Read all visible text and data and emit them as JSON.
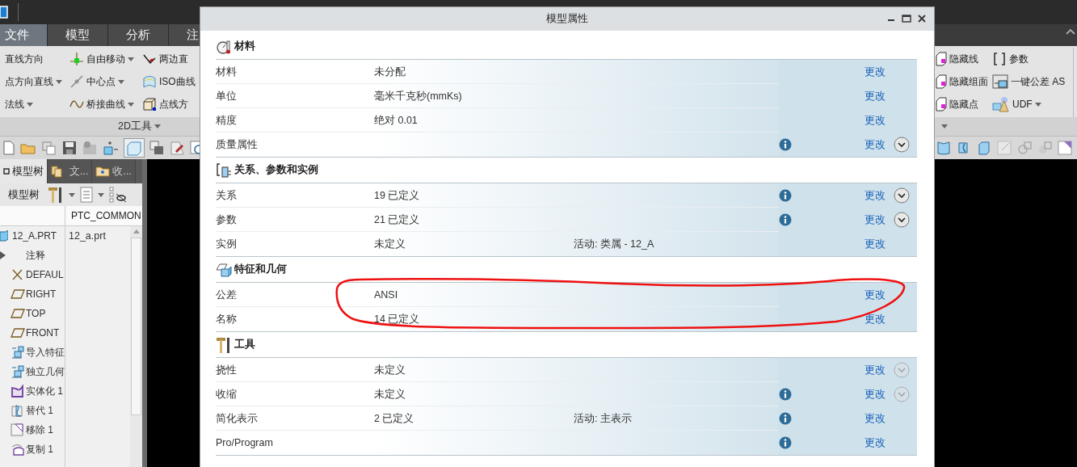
{
  "ribbon": {
    "tabs": [
      {
        "label": "文件",
        "selected": true
      },
      {
        "label": "模型",
        "selected": false
      },
      {
        "label": "分析",
        "selected": false
      },
      {
        "label": "注",
        "selected": false
      }
    ],
    "left_items": [
      {
        "label": "直线方向",
        "dropdown": false,
        "kind": "plain"
      },
      {
        "label": "自由移动",
        "dropdown": true,
        "kind": "axes"
      },
      {
        "label": "两边直",
        "dropdown": false,
        "kind": "angle"
      },
      {
        "label": "点方向直线",
        "dropdown": true,
        "kind": "plain"
      },
      {
        "label": "中心点",
        "dropdown": true,
        "kind": "line"
      },
      {
        "label": "ISO曲线",
        "dropdown": false,
        "kind": "surface"
      },
      {
        "label": "法线",
        "dropdown": true,
        "kind": "plain"
      },
      {
        "label": "桥接曲线",
        "dropdown": true,
        "kind": "curve"
      },
      {
        "label": "点线方",
        "dropdown": false,
        "kind": "cube"
      }
    ],
    "left_group": "2D工具",
    "right_items": [
      {
        "label": "隐藏线",
        "dropdown": false,
        "kind": "hide"
      },
      {
        "label": "参数",
        "dropdown": false,
        "kind": "brackets"
      },
      {
        "label": "隐藏组面",
        "dropdown": false,
        "kind": "hide"
      },
      {
        "label": "一键公差 AS",
        "dropdown": false,
        "kind": "frame"
      },
      {
        "label": "隐藏点",
        "dropdown": false,
        "kind": "hide"
      },
      {
        "label": "UDF",
        "dropdown": true,
        "kind": "cone"
      }
    ]
  },
  "panel": {
    "tabs": [
      {
        "label": "模型树",
        "selected": true,
        "kind": "square"
      },
      {
        "label": "文...",
        "selected": false,
        "kind": "folder"
      },
      {
        "label": "收...",
        "selected": false,
        "kind": "star-folder"
      }
    ],
    "toolbar_label": "模型树",
    "column_2": "PTC_COMMON",
    "tree": {
      "name": "12_A.PRT",
      "value": "12_a.prt",
      "children": [
        {
          "name": "注释",
          "kind": "plain",
          "expanded": false
        },
        {
          "name": "DEFAUL",
          "kind": "csys"
        },
        {
          "name": "RIGHT",
          "kind": "plane"
        },
        {
          "name": "TOP",
          "kind": "plane"
        },
        {
          "name": "FRONT",
          "kind": "plane"
        },
        {
          "name": "导入特征",
          "kind": "import"
        },
        {
          "name": "独立几何",
          "kind": "import"
        },
        {
          "name": "实体化 1",
          "kind": "solidify"
        },
        {
          "name": "替代 1",
          "kind": "substitute"
        },
        {
          "name": "移除 1",
          "kind": "remove"
        },
        {
          "name": "复制 1",
          "kind": "copy"
        }
      ]
    }
  },
  "dialog": {
    "title": "模型属性",
    "sections": [
      {
        "title": "材料",
        "kind": "material",
        "rows": [
          {
            "label": "材料",
            "value": "未分配",
            "info": false,
            "action": "更改",
            "circled": false
          },
          {
            "label": "单位",
            "value": "毫米千克秒(mmKs)",
            "info": false,
            "action": "更改",
            "circled": false
          },
          {
            "label": "精度",
            "value": "绝对 0.01",
            "info": false,
            "action": "更改",
            "circled": false
          },
          {
            "label": "质量属性",
            "info": true,
            "action": "更改",
            "circled": false,
            "expander": {
              "disabled": false
            }
          }
        ]
      },
      {
        "title": "关系、参数和实例",
        "kind": "relations",
        "rows": [
          {
            "label": "关系",
            "value": "19 已定义",
            "info": true,
            "action": "更改",
            "circled": false,
            "expander": {
              "disabled": false
            }
          },
          {
            "label": "参数",
            "value": "21 已定义",
            "info": true,
            "action": "更改",
            "circled": false,
            "expander": {
              "disabled": false
            }
          },
          {
            "label": "实例",
            "value": "未定义",
            "extra": "活动: 类属 - 12_A",
            "info": false,
            "action": "更改",
            "circled": false
          }
        ]
      },
      {
        "title": "特征和几何",
        "kind": "features",
        "rows": [
          {
            "label": "公差",
            "value": "ANSI",
            "info": false,
            "action": "更改",
            "circled": true
          },
          {
            "label": "名称",
            "value": "14 已定义",
            "info": false,
            "action": "更改",
            "circled": false
          }
        ]
      },
      {
        "title": "工具",
        "kind": "tools",
        "rows": [
          {
            "label": "挠性",
            "value": "未定义",
            "info": false,
            "action": "更改",
            "circled": false,
            "expander": {
              "disabled": true
            }
          },
          {
            "label": "收缩",
            "value": "未定义",
            "info": true,
            "action": "更改",
            "circled": false,
            "expander": {
              "disabled": true
            }
          },
          {
            "label": "简化表示",
            "value": "2 已定义",
            "extra": "活动: 主表示",
            "info": true,
            "action": "更改",
            "circled": false
          },
          {
            "label": "Pro/Program",
            "info": true,
            "action": "更改",
            "circled": false
          }
        ]
      }
    ]
  }
}
